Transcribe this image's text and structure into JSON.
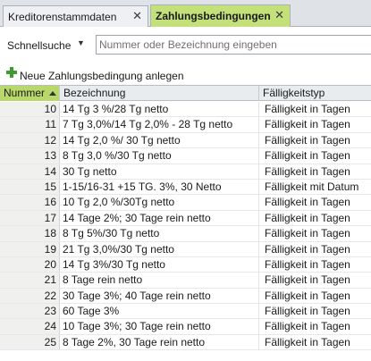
{
  "tabs": [
    {
      "label": "Kreditorenstammdaten",
      "active": false
    },
    {
      "label": "Zahlungsbedingungen",
      "active": true
    }
  ],
  "quick_search": {
    "label": "Schnellsuche",
    "placeholder": "Nummer oder Bezeichnung eingeben",
    "value": ""
  },
  "actions": {
    "new_label": "Neue Zahlungsbedingung anlegen"
  },
  "table": {
    "columns": {
      "number": "Nummer",
      "name": "Bezeichnung",
      "type": "Fälligkeitstyp"
    },
    "sort": {
      "column": "Nummer",
      "direction": "ascending"
    },
    "rows": [
      {
        "number": "10",
        "name": "14 Tg 3 %/28 Tg netto",
        "type": "Fälligkeit in Tagen"
      },
      {
        "number": "11",
        "name": "7 Tg 3,0%/14 Tg 2,0% - 28 Tg netto",
        "type": "Fälligkeit in Tagen"
      },
      {
        "number": "12",
        "name": "14 Tg 2,0 %/ 30 Tg netto",
        "type": "Fälligkeit in Tagen"
      },
      {
        "number": "13",
        "name": "8 Tg 3,0 %/30 Tg netto",
        "type": "Fälligkeit in Tagen"
      },
      {
        "number": "14",
        "name": "30 Tg  netto",
        "type": "Fälligkeit in Tagen"
      },
      {
        "number": "15",
        "name": "1-15/16-31 +15 TG. 3%, 30 Netto",
        "type": "Fälligkeit mit Datum"
      },
      {
        "number": "16",
        "name": "10 Tg 2,0 %/30Tg netto",
        "type": "Fälligkeit in Tagen"
      },
      {
        "number": "17",
        "name": "14 Tage 2%; 30 Tage rein netto",
        "type": "Fälligkeit in Tagen"
      },
      {
        "number": "18",
        "name": "8 Tg 5%/30 Tg netto",
        "type": "Fälligkeit in Tagen"
      },
      {
        "number": "19",
        "name": "21 Tg 3,0%/30 Tg netto",
        "type": "Fälligkeit in Tagen"
      },
      {
        "number": "20",
        "name": "14 Tg 3%/30 Tg netto",
        "type": "Fälligkeit in Tagen"
      },
      {
        "number": "21",
        "name": "8 Tage rein netto",
        "type": "Fälligkeit in Tagen"
      },
      {
        "number": "22",
        "name": "30 Tage 3%; 40 Tage rein netto",
        "type": "Fälligkeit in Tagen"
      },
      {
        "number": "23",
        "name": "60 Tage 3%",
        "type": "Fälligkeit in Tagen"
      },
      {
        "number": "24",
        "name": "10 Tage 3%; 30 Tage rein netto",
        "type": "Fälligkeit in Tagen"
      },
      {
        "number": "25",
        "name": "8 Tage 2%, 30 Tage rein netto",
        "type": "Fälligkeit in Tagen"
      }
    ]
  },
  "colors": {
    "active_tab": "#c4e07a",
    "sorted_header": "#b8d96a",
    "add_icon": "#3e9b2f"
  }
}
